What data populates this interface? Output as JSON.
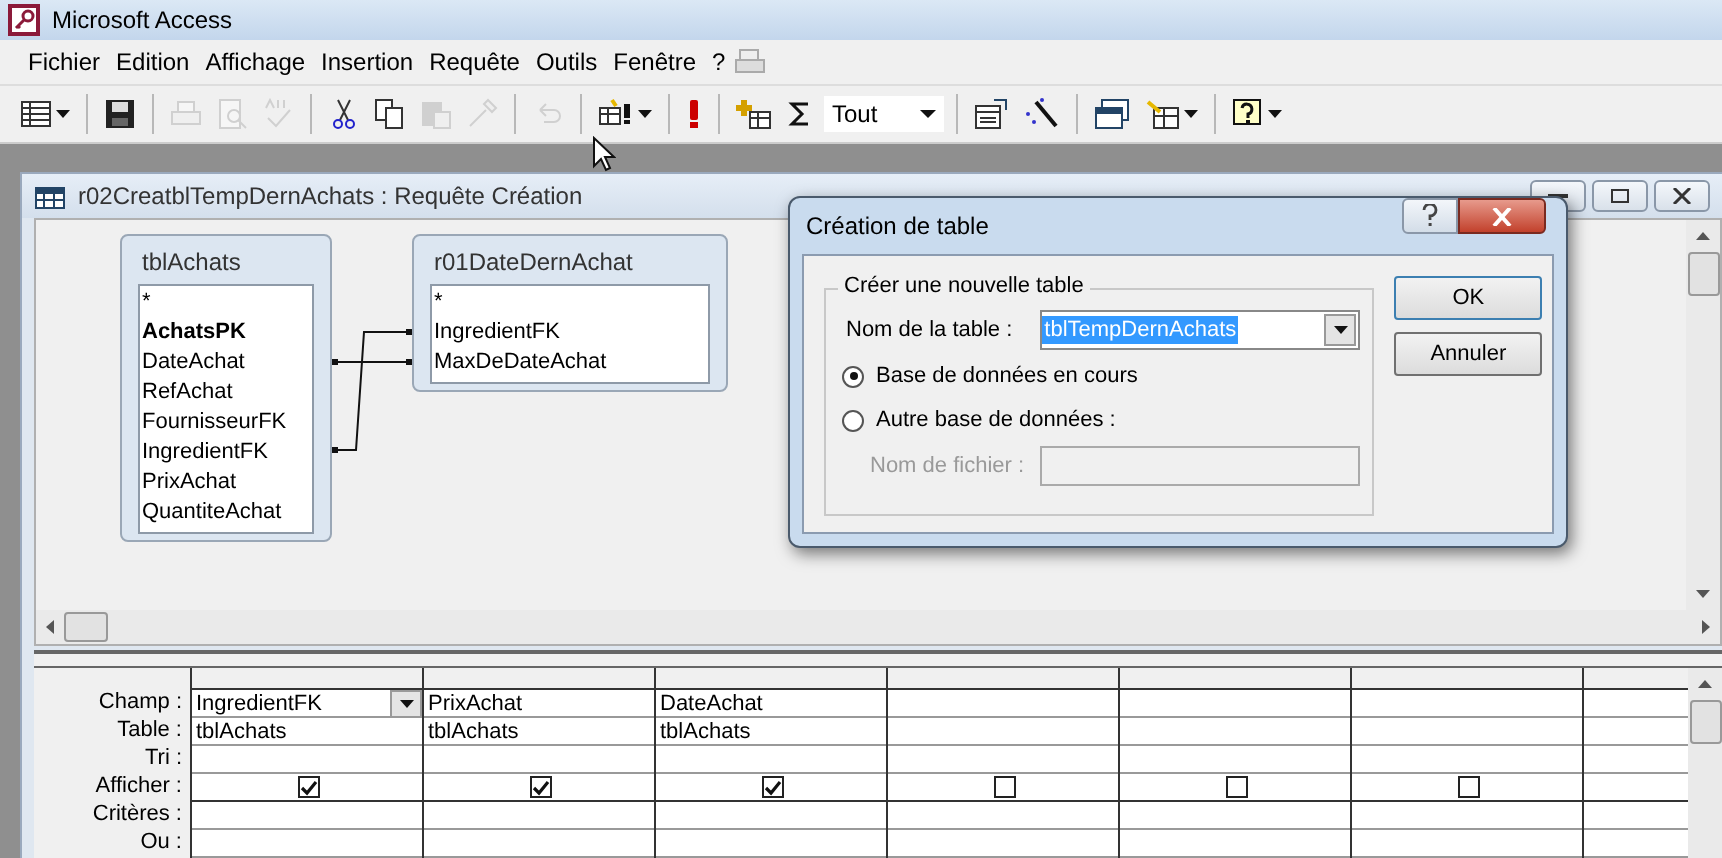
{
  "window": {
    "title": "Microsoft Access"
  },
  "menu": [
    {
      "label": "Fichier"
    },
    {
      "label": "Edition"
    },
    {
      "label": "Affichage"
    },
    {
      "label": "Insertion"
    },
    {
      "label": "Requête"
    },
    {
      "label": "Outils"
    },
    {
      "label": "Fenêtre"
    },
    {
      "label": "?"
    }
  ],
  "toolbar": [
    {
      "kind": "view",
      "disabled": false,
      "dropdown": true
    },
    {
      "kind": "sep"
    },
    {
      "kind": "save",
      "disabled": false
    },
    {
      "kind": "sep"
    },
    {
      "kind": "print",
      "disabled": true
    },
    {
      "kind": "preview",
      "disabled": true
    },
    {
      "kind": "spell",
      "disabled": true
    },
    {
      "kind": "sep"
    },
    {
      "kind": "cut",
      "disabled": false
    },
    {
      "kind": "copy",
      "disabled": false
    },
    {
      "kind": "paste",
      "disabled": true
    },
    {
      "kind": "brush",
      "disabled": true
    },
    {
      "kind": "sep"
    },
    {
      "kind": "undo",
      "disabled": true
    },
    {
      "kind": "sep"
    },
    {
      "kind": "querytype",
      "disabled": false,
      "dropdown": true
    },
    {
      "kind": "sep"
    },
    {
      "kind": "run",
      "disabled": false
    },
    {
      "kind": "sep"
    },
    {
      "kind": "showtable",
      "disabled": false
    },
    {
      "kind": "totals",
      "disabled": false
    },
    {
      "kind": "combo",
      "value": "Tout"
    },
    {
      "kind": "sep"
    },
    {
      "kind": "properties",
      "disabled": false
    },
    {
      "kind": "builder",
      "disabled": false
    },
    {
      "kind": "sep"
    },
    {
      "kind": "dbwindow",
      "disabled": false
    },
    {
      "kind": "newobject",
      "disabled": false,
      "dropdown": true
    },
    {
      "kind": "sep"
    },
    {
      "kind": "help",
      "disabled": false,
      "dropdown": true
    }
  ],
  "query_window": {
    "title": "r02CreatblTempDernAchats : Requête Création",
    "tables": [
      {
        "name": "tblAchats",
        "fields": [
          {
            "label": "*",
            "key": false
          },
          {
            "label": "AchatsPK",
            "key": true
          },
          {
            "label": "DateAchat",
            "key": false
          },
          {
            "label": "RefAchat",
            "key": false
          },
          {
            "label": "FournisseurFK",
            "key": false
          },
          {
            "label": "IngredientFK",
            "key": false
          },
          {
            "label": "PrixAchat",
            "key": false
          },
          {
            "label": "QuantiteAchat",
            "key": false
          }
        ]
      },
      {
        "name": "r01DateDernAchat",
        "fields": [
          {
            "label": "*",
            "key": false
          },
          {
            "label": "IngredientFK",
            "key": false
          },
          {
            "label": "MaxDeDateAchat",
            "key": false
          }
        ]
      }
    ],
    "grid": {
      "row_labels": [
        "Champ :",
        "Table :",
        "Tri :",
        "Afficher :",
        "Critères :",
        "Ou :"
      ],
      "columns": [
        {
          "field": "IngredientFK",
          "table": "tblAchats",
          "show": true,
          "dropdown": true
        },
        {
          "field": "PrixAchat",
          "table": "tblAchats",
          "show": true
        },
        {
          "field": "DateAchat",
          "table": "tblAchats",
          "show": true
        },
        {
          "show": false
        },
        {
          "show": false
        },
        {
          "show": false
        },
        {}
      ]
    }
  },
  "dialog": {
    "title": "Création de table",
    "group": "Créer une nouvelle table",
    "name_label": "Nom de la table :",
    "name_value": "tblTempDernAchats",
    "name_value_selected": true,
    "options": [
      {
        "label": "Base de données en cours",
        "selected": true
      },
      {
        "label": "Autre base de données :",
        "selected": false
      }
    ],
    "file_label": "Nom de fichier :",
    "file_disabled": true,
    "buttons": [
      "OK",
      "Annuler"
    ]
  }
}
